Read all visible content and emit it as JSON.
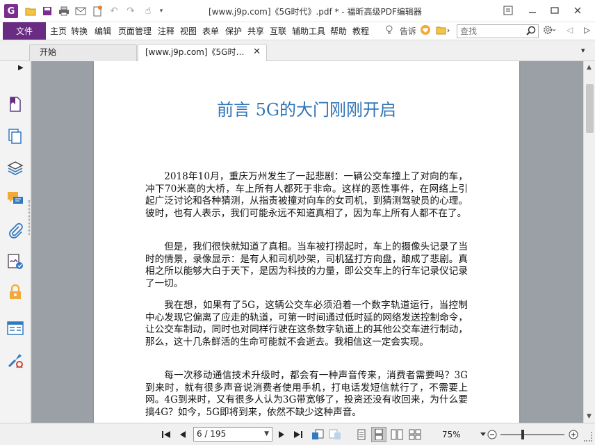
{
  "window": {
    "title": "[www.j9p.com]《5G时代》.pdf * - 福昕高级PDF编辑器",
    "app_logo": "G",
    "controls": [
      "restore-icon",
      "minimize-icon",
      "maximize-icon",
      "close-icon"
    ]
  },
  "quick_access": [
    "open-icon",
    "save-icon",
    "print-icon",
    "email-icon",
    "new-icon",
    "undo-icon",
    "redo-icon",
    "hand-tool-icon",
    "dropdown-icon"
  ],
  "menubar": {
    "file_label": "文件",
    "items": [
      "主页",
      "转换",
      "编辑",
      "页面管理",
      "注释",
      "视图",
      "表单",
      "保护",
      "共享",
      "互联",
      "辅助工具",
      "帮助",
      "教程"
    ],
    "tell_me": "告诉",
    "search_placeholder": "查找"
  },
  "tabs": [
    {
      "label": "开始",
      "active": false
    },
    {
      "label": "[www.j9p.com]《5G时…",
      "active": true
    }
  ],
  "sidebar_icons": [
    "bookmark-icon",
    "pages-icon",
    "layers-icon",
    "comments-icon",
    "attachment-icon",
    "signature-icon",
    "security-icon",
    "form-fields-icon",
    "tools-icon"
  ],
  "document": {
    "title": "前言 5G的大门刚刚开启",
    "paragraphs": [
      "2018年10月，重庆万州发生了一起悲剧：一辆公交车撞上了对向的车，冲下70米高的大桥，车上所有人都死于非命。这样的恶性事件，在网络上引起广泛讨论和各种猜测，从指责被撞对向车的女司机，到猜测驾驶员的心理。彼时，也有人表示，我们可能永远不知道真相了，因为车上所有人都不在了。",
      "但是，我们很快就知道了真相。当车被打捞起时，车上的摄像头记录了当时的情景，录像显示：是有人和司机吵架，司机猛打方向盘，酿成了悲剧。真相之所以能够大白于天下，是因为科技的力量，即公交车上的行车记录仪记录了一切。",
      "我在想，如果有了5G，这辆公交车必须沿着一个数字轨道运行，当控制中心发现它偏离了应走的轨道，可第一时间通过低时延的网络发送控制命令，让公交车制动，同时也对同样行驶在这条数字轨道上的其他公交车进行制动，那么，这十几条鲜活的生命可能就不会逝去。我相信这一定会实现。",
      "每一次移动通信技术升级时，都会有一种声音传来，消费者需要吗？3G到来时，就有很多声音说消费者使用手机，打电话发短信就行了，不需要上网。4G到来时，又有很多人认为3G带宽够了，投资还没有收回来，为什么要搞4G？如今，5G即将到来，依然不缺少这种声音。"
    ]
  },
  "statusbar": {
    "page_indicator": "6 / 195",
    "zoom": "75%",
    "zoom_fraction": 0.35
  },
  "colors": {
    "accent": "#6a2c82",
    "title_blue": "#2f74b6",
    "doc_background": "#9aa0a6"
  }
}
